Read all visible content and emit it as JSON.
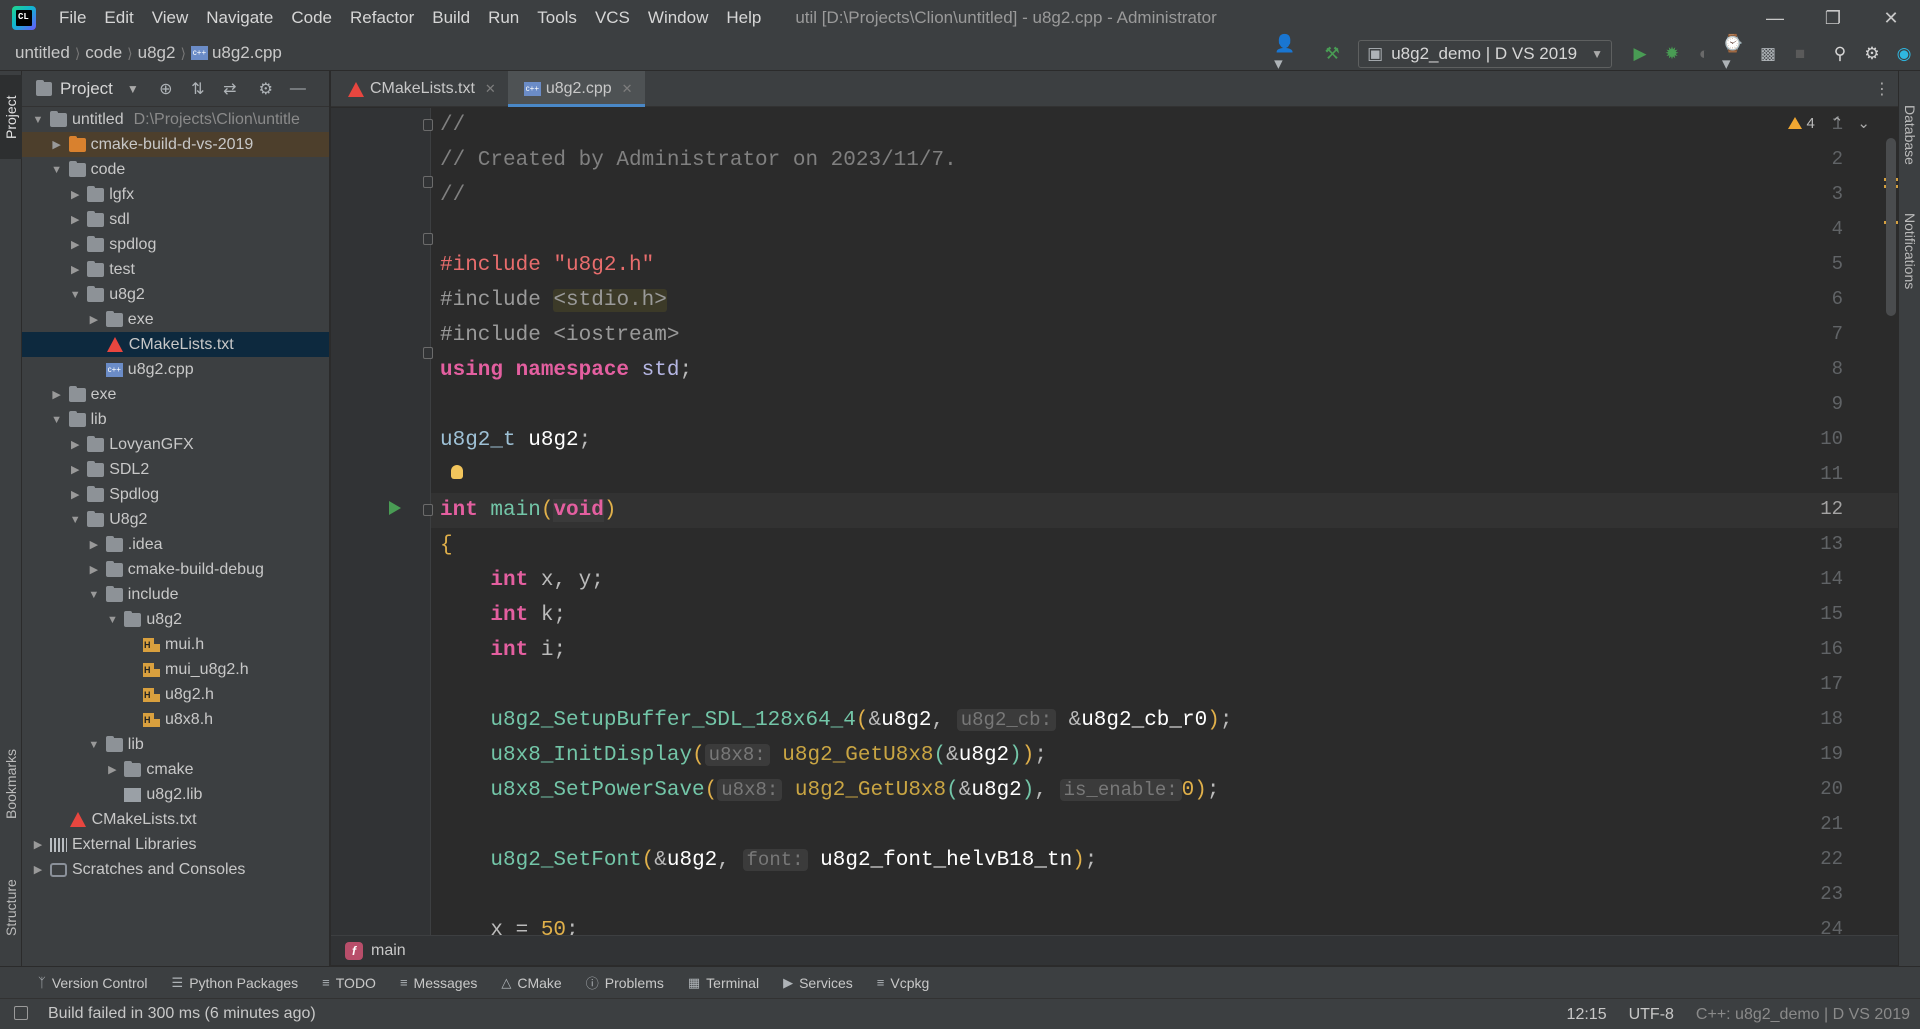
{
  "window": {
    "title": "util [D:\\Projects\\Clion\\untitled] - u8g2.cpp - Administrator",
    "controls": [
      "minimize",
      "restore",
      "close"
    ]
  },
  "menu": [
    "File",
    "Edit",
    "View",
    "Navigate",
    "Code",
    "Refactor",
    "Build",
    "Run",
    "Tools",
    "VCS",
    "Window",
    "Help"
  ],
  "breadcrumb": [
    "untitled",
    "code",
    "u8g2",
    "u8g2.cpp"
  ],
  "run_config": "u8g2_demo | D VS 2019",
  "project_panel": {
    "title": "Project",
    "root_label": "untitled",
    "root_path": "D:\\Projects\\Clion\\untitle",
    "items": [
      {
        "label": "cmake-build-d-vs-2019",
        "depth": 1,
        "type": "folder-orange",
        "expanded": false
      },
      {
        "label": "code",
        "depth": 1,
        "type": "folder",
        "expanded": true
      },
      {
        "label": "lgfx",
        "depth": 2,
        "type": "folder",
        "expanded": false
      },
      {
        "label": "sdl",
        "depth": 2,
        "type": "folder",
        "expanded": false
      },
      {
        "label": "spdlog",
        "depth": 2,
        "type": "folder",
        "expanded": false
      },
      {
        "label": "test",
        "depth": 2,
        "type": "folder",
        "expanded": false
      },
      {
        "label": "u8g2",
        "depth": 2,
        "type": "folder",
        "expanded": true
      },
      {
        "label": "exe",
        "depth": 3,
        "type": "folder",
        "expanded": false
      },
      {
        "label": "CMakeLists.txt",
        "depth": 3,
        "type": "cmake",
        "selected": true
      },
      {
        "label": "u8g2.cpp",
        "depth": 3,
        "type": "cpp"
      },
      {
        "label": "exe",
        "depth": 1,
        "type": "folder",
        "expanded": false
      },
      {
        "label": "lib",
        "depth": 1,
        "type": "folder",
        "expanded": true
      },
      {
        "label": "LovyanGFX",
        "depth": 2,
        "type": "folder",
        "expanded": false
      },
      {
        "label": "SDL2",
        "depth": 2,
        "type": "folder",
        "expanded": false
      },
      {
        "label": "Spdlog",
        "depth": 2,
        "type": "folder",
        "expanded": false
      },
      {
        "label": "U8g2",
        "depth": 2,
        "type": "folder",
        "expanded": true
      },
      {
        "label": ".idea",
        "depth": 3,
        "type": "folder",
        "expanded": false
      },
      {
        "label": "cmake-build-debug",
        "depth": 3,
        "type": "folder",
        "expanded": false
      },
      {
        "label": "include",
        "depth": 3,
        "type": "folder",
        "expanded": true
      },
      {
        "label": "u8g2",
        "depth": 4,
        "type": "folder",
        "expanded": true
      },
      {
        "label": "mui.h",
        "depth": 5,
        "type": "h"
      },
      {
        "label": "mui_u8g2.h",
        "depth": 5,
        "type": "h"
      },
      {
        "label": "u8g2.h",
        "depth": 5,
        "type": "h"
      },
      {
        "label": "u8x8.h",
        "depth": 5,
        "type": "h"
      },
      {
        "label": "lib",
        "depth": 3,
        "type": "folder",
        "expanded": true
      },
      {
        "label": "cmake",
        "depth": 4,
        "type": "folder",
        "expanded": false
      },
      {
        "label": "u8g2.lib",
        "depth": 4,
        "type": "lib"
      },
      {
        "label": "CMakeLists.txt",
        "depth": 1,
        "type": "cmake"
      },
      {
        "label": "External Libraries",
        "depth": 0,
        "type": "libs",
        "expanded": false
      },
      {
        "label": "Scratches and Consoles",
        "depth": 0,
        "type": "scratch",
        "expanded": false
      }
    ]
  },
  "tabs": [
    {
      "label": "CMakeLists.txt",
      "active": false
    },
    {
      "label": "u8g2.cpp",
      "active": true
    }
  ],
  "editor": {
    "warning_count": "4",
    "current_line": 12,
    "line_numbers": [
      "1",
      "2",
      "3",
      "4",
      "5",
      "6",
      "7",
      "8",
      "9",
      "10",
      "11",
      "12",
      "13",
      "14",
      "15",
      "16",
      "17",
      "18",
      "19",
      "20",
      "21",
      "22",
      "23",
      "24"
    ],
    "inlay_hints": [
      "u8g2_cb:",
      "u8x8:",
      "u8x8:",
      "is_enable:",
      "font:"
    ]
  },
  "editor_breadcrumb": "main",
  "left_tabs": [
    "Project",
    "Bookmarks",
    "Structure"
  ],
  "right_tabs": [
    "Database",
    "Notifications"
  ],
  "tool_windows": [
    "Version Control",
    "Python Packages",
    "TODO",
    "Messages",
    "CMake",
    "Problems",
    "Terminal",
    "Services",
    "Vcpkg"
  ],
  "status": {
    "message": "Build failed in 300 ms (6 minutes ago)",
    "position": "12:15",
    "encoding": "UTF-8",
    "context": "C++: u8g2_demo | D VS 2019"
  }
}
